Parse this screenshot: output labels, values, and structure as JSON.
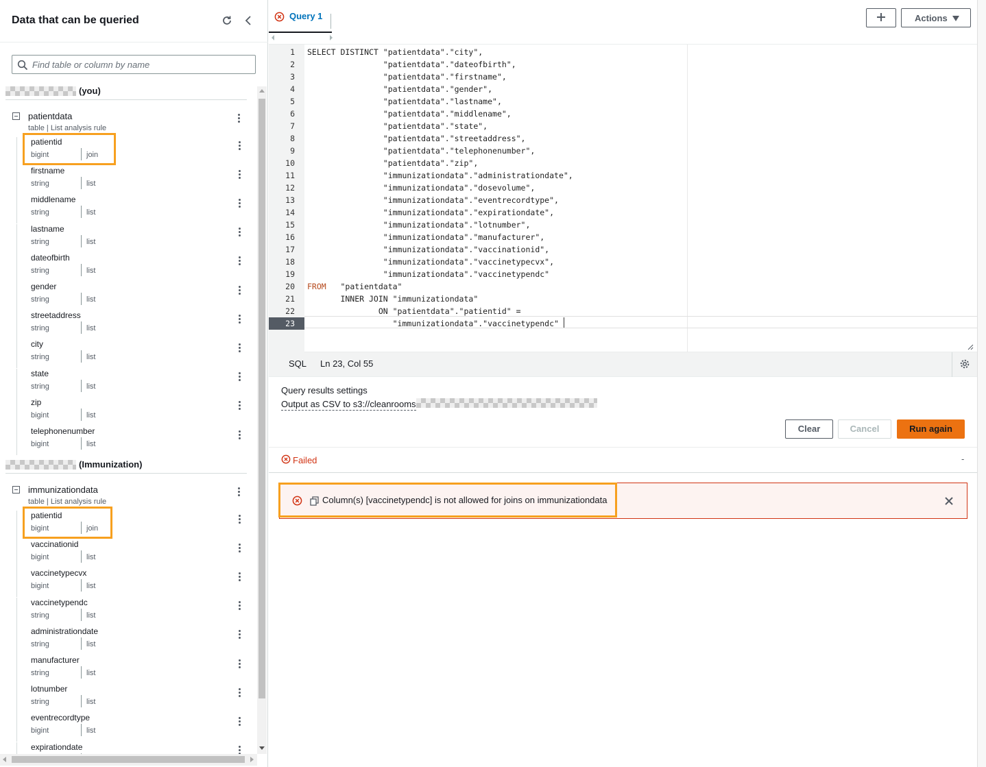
{
  "left_panel": {
    "title": "Data that can be queried",
    "search_placeholder": "Find table or column by name",
    "groups": [
      {
        "label": "(you)",
        "table": {
          "name": "patientdata",
          "subtitle": "table | List analysis rule",
          "columns": [
            {
              "name": "patientid",
              "type": "bigint",
              "rule": "join"
            },
            {
              "name": "firstname",
              "type": "string",
              "rule": "list"
            },
            {
              "name": "middlename",
              "type": "string",
              "rule": "list"
            },
            {
              "name": "lastname",
              "type": "string",
              "rule": "list"
            },
            {
              "name": "dateofbirth",
              "type": "string",
              "rule": "list"
            },
            {
              "name": "gender",
              "type": "string",
              "rule": "list"
            },
            {
              "name": "streetaddress",
              "type": "string",
              "rule": "list"
            },
            {
              "name": "city",
              "type": "string",
              "rule": "list"
            },
            {
              "name": "state",
              "type": "string",
              "rule": "list"
            },
            {
              "name": "zip",
              "type": "bigint",
              "rule": "list"
            },
            {
              "name": "telephonenumber",
              "type": "bigint",
              "rule": "list"
            }
          ]
        }
      },
      {
        "label": "(Immunization)",
        "table": {
          "name": "immunizationdata",
          "subtitle": "table | List analysis rule",
          "columns": [
            {
              "name": "patientid",
              "type": "bigint",
              "rule": "join"
            },
            {
              "name": "vaccinationid",
              "type": "bigint",
              "rule": "list"
            },
            {
              "name": "vaccinetypecvx",
              "type": "bigint",
              "rule": "list"
            },
            {
              "name": "vaccinetypendc",
              "type": "string",
              "rule": "list"
            },
            {
              "name": "administrationdate",
              "type": "string",
              "rule": "list"
            },
            {
              "name": "manufacturer",
              "type": "string",
              "rule": "list"
            },
            {
              "name": "lotnumber",
              "type": "string",
              "rule": "list"
            },
            {
              "name": "eventrecordtype",
              "type": "bigint",
              "rule": "list"
            },
            {
              "name": "expirationdate",
              "type": "",
              "rule": ""
            }
          ]
        }
      }
    ]
  },
  "tabs": [
    {
      "label": "Query 1",
      "status": "error"
    }
  ],
  "toolbar": {
    "add_icon": "plus-icon",
    "actions_label": "Actions"
  },
  "editor": {
    "lines": [
      "SELECT DISTINCT \"patientdata\".\"city\",",
      "                \"patientdata\".\"dateofbirth\",",
      "                \"patientdata\".\"firstname\",",
      "                \"patientdata\".\"gender\",",
      "                \"patientdata\".\"lastname\",",
      "                \"patientdata\".\"middlename\",",
      "                \"patientdata\".\"state\",",
      "                \"patientdata\".\"streetaddress\",",
      "                \"patientdata\".\"telephonenumber\",",
      "                \"patientdata\".\"zip\",",
      "                \"immunizationdata\".\"administrationdate\",",
      "                \"immunizationdata\".\"dosevolume\",",
      "                \"immunizationdata\".\"eventrecordtype\",",
      "                \"immunizationdata\".\"expirationdate\",",
      "                \"immunizationdata\".\"lotnumber\",",
      "                \"immunizationdata\".\"manufacturer\",",
      "                \"immunizationdata\".\"vaccinationid\",",
      "                \"immunizationdata\".\"vaccinetypecvx\",",
      "                \"immunizationdata\".\"vaccinetypendc\"",
      "FROM   \"patientdata\"",
      "       INNER JOIN \"immunizationdata\"",
      "               ON \"patientdata\".\"patientid\" =",
      "                  \"immunizationdata\".\"vaccinetypendc\""
    ],
    "active_line": 23,
    "language": "SQL",
    "cursor_position": "Ln 23, Col 55"
  },
  "results_settings": {
    "title": "Query results settings",
    "output": "Output as CSV to s3://cleanrooms"
  },
  "buttons": {
    "clear": "Clear",
    "cancel": "Cancel",
    "run": "Run again"
  },
  "status": {
    "label": "Failed",
    "dash": "-"
  },
  "alert": {
    "message": "Column(s) [vaccinetypendc] is not allowed for joins on immunizationdata"
  },
  "colors": {
    "accent": "#0073bb",
    "primary_button": "#ec7211",
    "error": "#d13212",
    "highlight": "#f7a01f"
  }
}
